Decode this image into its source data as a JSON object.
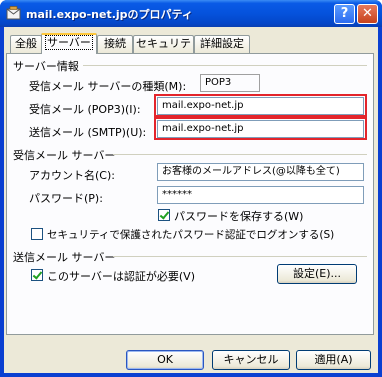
{
  "window": {
    "title": "mail.expo-net.jpのプロパティ",
    "help_label": "?",
    "close_label": "✕"
  },
  "tabs": [
    {
      "label": "全般"
    },
    {
      "label": "サーバー"
    },
    {
      "label": "接続"
    },
    {
      "label": "セキュリティ"
    },
    {
      "label": "詳細設定"
    }
  ],
  "server_info": {
    "heading": "サーバー情報",
    "type_label": "受信メール サーバーの種類(M):",
    "type_value": "POP3",
    "incoming_label": "受信メール (POP3)(I):",
    "incoming_value": "mail.expo-net.jp",
    "outgoing_label": "送信メール (SMTP)(U):",
    "outgoing_value": "mail.expo-net.jp"
  },
  "incoming_server": {
    "heading": "受信メール サーバー",
    "account_label": "アカウント名(C):",
    "account_value": "お客様のメールアドレス(@以降も全て)",
    "password_label": "パスワード(P):",
    "password_value": "******",
    "remember_label": "パスワードを保存する(W)",
    "remember_checked": true,
    "spa_label": "セキュリティで保護されたパスワード認証でログオンする(S)",
    "spa_checked": false
  },
  "outgoing_server": {
    "heading": "送信メール サーバー",
    "auth_label": "このサーバーは認証が必要(V)",
    "auth_checked": true,
    "settings_button": "設定(E)..."
  },
  "buttons": {
    "ok": "OK",
    "cancel": "キャンセル",
    "apply": "適用(A)"
  },
  "colors": {
    "highlight": "#e3242b",
    "titlebar": "#0552dc",
    "dialog_bg": "#ece9d8"
  }
}
